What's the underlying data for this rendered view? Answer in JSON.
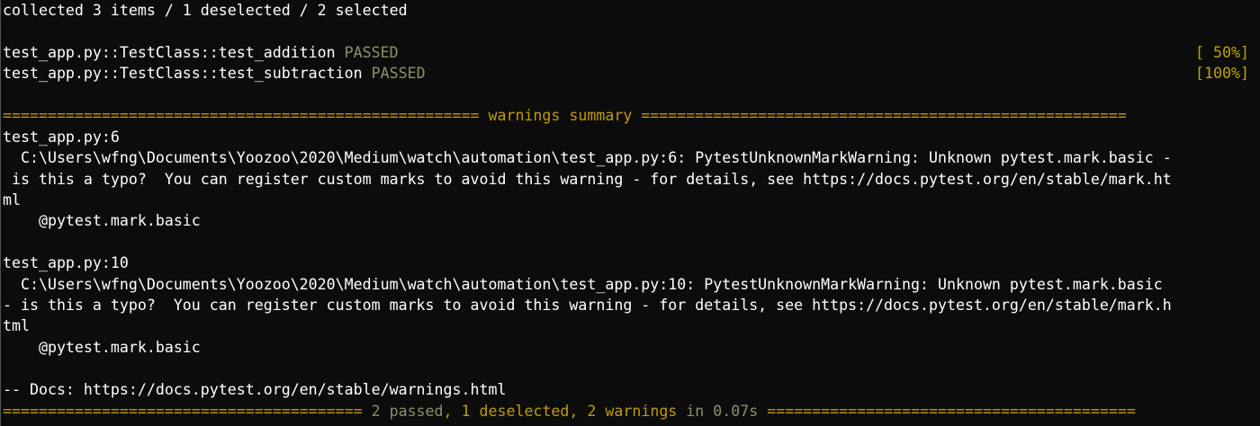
{
  "colors": {
    "background": "#0c0c0c",
    "text": "#ffffff",
    "yellow": "#c19c00",
    "dim_passed": "#8f8f6b"
  },
  "header": {
    "collected": "collected 3 items / 1 deselected / 2 selected"
  },
  "tests": [
    {
      "name": "test_app.py::TestClass::test_addition",
      "status": "PASSED",
      "progress": "[ 50%]"
    },
    {
      "name": "test_app.py::TestClass::test_subtraction",
      "status": "PASSED",
      "progress": "[100%]"
    }
  ],
  "warnings": {
    "header": "===================================================== warnings summary ======================================================",
    "items": [
      {
        "location": "test_app.py:6",
        "line1": "  C:\\Users\\wfng\\Documents\\Yoozoo\\2020\\Medium\\watch\\automation\\test_app.py:6: PytestUnknownMarkWarning: Unknown pytest.mark.basic -",
        "line2": " is this a typo?  You can register custom marks to avoid this warning - for details, see https://docs.pytest.org/en/stable/mark.ht",
        "line3": "ml",
        "code": "    @pytest.mark.basic"
      },
      {
        "location": "test_app.py:10",
        "line1": "  C:\\Users\\wfng\\Documents\\Yoozoo\\2020\\Medium\\watch\\automation\\test_app.py:10: PytestUnknownMarkWarning: Unknown pytest.mark.basic",
        "line2": "- is this a typo?  You can register custom marks to avoid this warning - for details, see https://docs.pytest.org/en/stable/mark.h",
        "line3": "tml",
        "code": "    @pytest.mark.basic"
      }
    ],
    "docs": "-- Docs: https://docs.pytest.org/en/stable/warnings.html"
  },
  "footer": {
    "left_rule": "======================================== ",
    "passed": "2 passed",
    "sep": ", 1 deselected, 2 warnings ",
    "time": "in 0.07s",
    "right_rule": " ========================================="
  }
}
